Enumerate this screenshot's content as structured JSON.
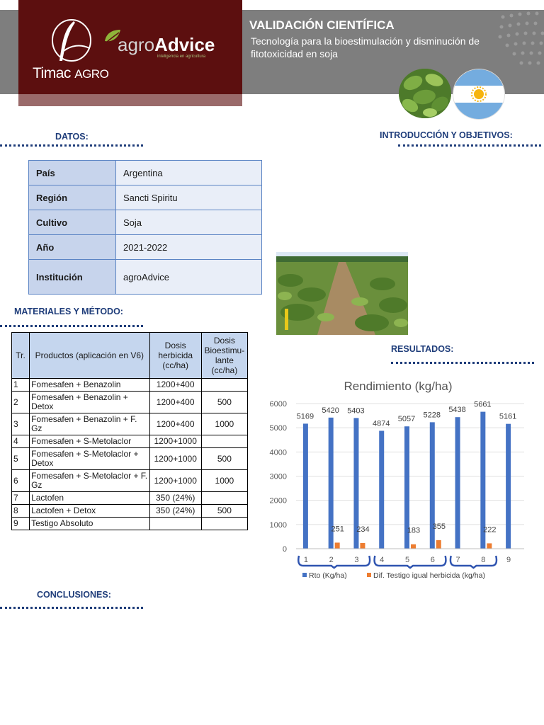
{
  "header": {
    "title": "VALIDACIÓN CIENTÍFICA",
    "subtitle": "Tecnología para la bioestimulación y disminución de fitotoxicidad en soja",
    "logo_timac": "Timac",
    "logo_timac_suffix": "AGRO",
    "logo_agro_prefix": "agro",
    "logo_agro_bold": "Advice",
    "logo_agro_tagline": "inteligencia en agricultura",
    "flag_icon": "argentina-flag-icon",
    "crop_icon": "soybean-leaves-photo"
  },
  "sections": {
    "datos": "DATOS:",
    "intro": "INTRODUCCIÓN Y OBJETIVOS:",
    "materiales": "MATERIALES Y MÉTODO:",
    "resultados": "RESULTADOS:",
    "conclusiones": "CONCLUSIONES:"
  },
  "datos": [
    {
      "label": "País",
      "value": "Argentina"
    },
    {
      "label": "Región",
      "value": "Sancti Spiritu"
    },
    {
      "label": "Cultivo",
      "value": "Soja"
    },
    {
      "label": "Año",
      "value": "2021-2022"
    },
    {
      "label": "Institución",
      "value": "agroAdvice"
    }
  ],
  "materiales": {
    "headers": [
      "Tr.",
      "Productos (aplicación en V6)",
      "Dosis herbicida (cc/ha)",
      "Dosis Bioestimu-lante (cc/ha)"
    ],
    "rows": [
      [
        "1",
        "Fomesafen + Benazolin",
        "1200+400",
        ""
      ],
      [
        "2",
        "Fomesafen + Benazolin + Detox",
        "1200+400",
        "500"
      ],
      [
        "3",
        "Fomesafen + Benazolin + F. Gz",
        "1200+400",
        "1000"
      ],
      [
        "4",
        "Fomesafen + S-Metolaclor",
        "1200+1000",
        ""
      ],
      [
        "5",
        "Fomesafen + S-Metolaclor + Detox",
        "1200+1000",
        "500"
      ],
      [
        "6",
        "Fomesafen + S-Metolaclor + F. Gz",
        "1200+1000",
        "1000"
      ],
      [
        "7",
        "Lactofen",
        "350 (24%)",
        ""
      ],
      [
        "8",
        "Lactofen + Detox",
        "350 (24%)",
        "500"
      ],
      [
        "9",
        "Testigo Absoluto",
        "",
        ""
      ]
    ]
  },
  "colors": {
    "header_band": "#7e7e7e",
    "logo_bg": "#5c0f0f",
    "section_title": "#1f3d7a",
    "series_rto": "#4472c4",
    "series_dif": "#ed7d31"
  },
  "chart_data": {
    "type": "bar",
    "title": "Rendimiento (kg/ha)",
    "categories": [
      "1",
      "2",
      "3",
      "4",
      "5",
      "6",
      "7",
      "8",
      "9"
    ],
    "ylim": [
      0,
      6000
    ],
    "yticks": [
      0,
      1000,
      2000,
      3000,
      4000,
      5000,
      6000
    ],
    "grid": true,
    "legend_position": "bottom",
    "series": [
      {
        "name": "Rto (Kg/ha)",
        "values": [
          5169,
          5420,
          5403,
          4874,
          5057,
          5228,
          5438,
          5661,
          5161
        ],
        "labels": [
          "5169",
          "5420",
          "5403",
          "4874",
          "5057",
          "5228",
          "5438",
          "5661",
          "5161"
        ]
      },
      {
        "name": "Dif. Testigo igual herbicida (kg/ha)",
        "values": [
          null,
          251,
          234,
          null,
          183,
          355,
          null,
          222,
          null
        ],
        "labels": [
          "",
          "251",
          "234",
          "",
          "183",
          "355",
          "",
          "222",
          ""
        ]
      }
    ],
    "groups": [
      [
        1,
        3
      ],
      [
        4,
        6
      ],
      [
        7,
        8
      ]
    ]
  }
}
